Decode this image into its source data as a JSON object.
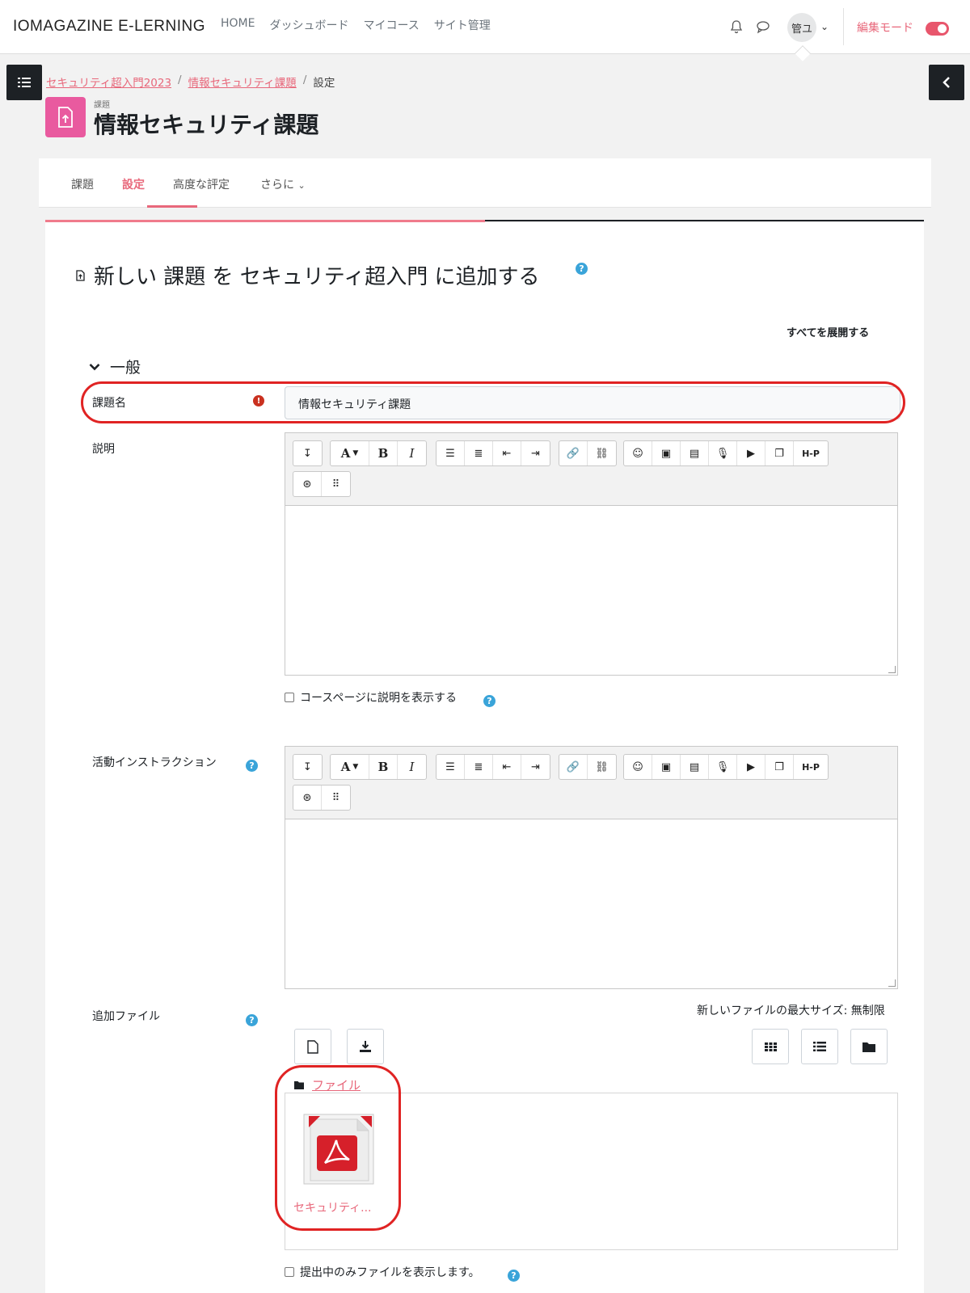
{
  "navbar": {
    "brand": "IOMAGAZINE E-LERNING",
    "links": [
      "HOME",
      "ダッシュボード",
      "マイコース",
      "サイト管理"
    ],
    "avatar_initials": "管ユ",
    "edit_mode_label": "編集モード",
    "edit_mode_on": true
  },
  "breadcrumb": {
    "items": [
      "セキュリティ超入門2023",
      "情報セキュリティ課題",
      "設定"
    ],
    "separator": "/"
  },
  "header": {
    "activity_type": "課題",
    "title": "情報セキュリティ課題"
  },
  "secondary_nav": {
    "tabs": [
      "課題",
      "設定",
      "高度な評定",
      "さらに"
    ],
    "active_tab": "設定"
  },
  "form": {
    "heading": "新しい 課題 を セキュリティ超入門 に追加する",
    "expand_all": "すべてを展開する",
    "section_general": "一般",
    "name_label": "課題名",
    "name_value": "情報セキュリティ課題",
    "description_label": "説明",
    "show_description_label": "コースページに説明を表示する",
    "activity_instructions_label": "活動インストラクション",
    "additional_files_label": "追加ファイル",
    "max_size_text": "新しいファイルの最大サイズ: 無制限",
    "files_folder_label": "ファイル",
    "file_name": "セキュリティ...",
    "only_show_during_submission_label": "提出中のみファイルを表示します。"
  },
  "toolbar_buttons": {
    "bold": "B",
    "italic": "I",
    "font": "A",
    "h5p": "H-P"
  },
  "colors": {
    "accent": "#e8687b",
    "activity_icon": "#e95a9f",
    "help": "#3aa4d9",
    "required": "#ca3120",
    "highlight_outline": "#e02323"
  }
}
